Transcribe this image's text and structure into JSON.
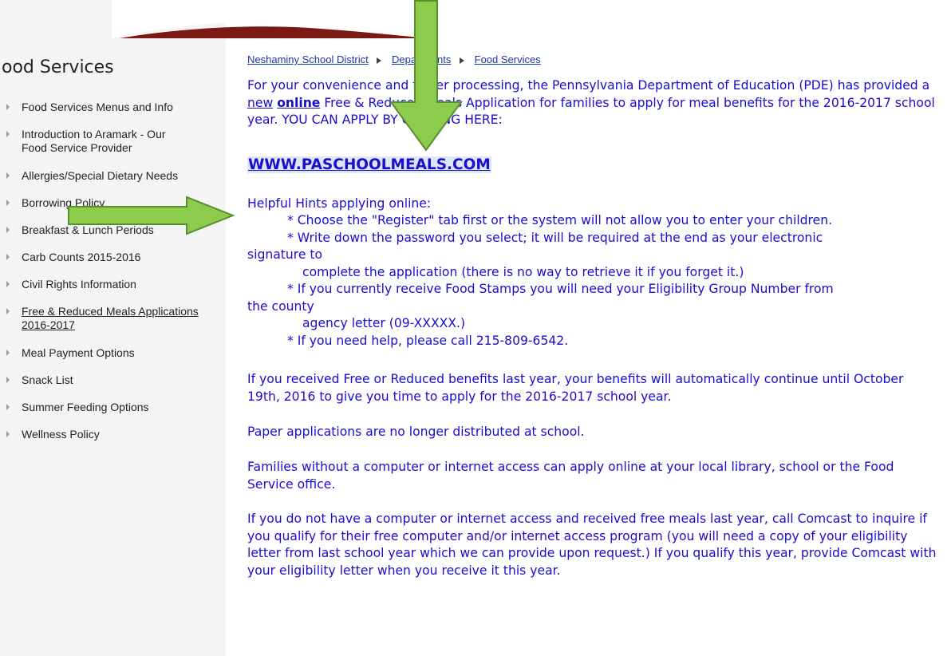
{
  "sidebar": {
    "title": "ood Services",
    "items": [
      {
        "label": "Food Services Menus and Info"
      },
      {
        "label": "Introduction to Aramark - Our Food Service Provider"
      },
      {
        "label": "Allergies/Special Dietary Needs"
      },
      {
        "label": "Borrowing Policy"
      },
      {
        "label": "Breakfast & Lunch Periods"
      },
      {
        "label": "Carb Counts 2015-2016"
      },
      {
        "label": "Civil Rights Information"
      },
      {
        "label": "Free & Reduced Meals Applications 2016-2017"
      },
      {
        "label": "Meal Payment Options"
      },
      {
        "label": "Snack List"
      },
      {
        "label": "Summer Feeding Options"
      },
      {
        "label": "Wellness Policy"
      }
    ]
  },
  "breadcrumb": {
    "district": "Neshaminy School District",
    "departments": "Departments",
    "current": "Food Services"
  },
  "content": {
    "intro_part1": "For your convenience and faster processing, the Pennsylvania Department of Education (PDE) has provided a ",
    "intro_new": "new",
    "intro_online": "online",
    "intro_part2": " Free & Reduced Meals Application for families to apply for meal benefits for the 2016-2017 school year.  YOU CAN APPLY BY CLICKING HERE:",
    "site_link": "WWW.PASCHOOLMEALS.COM",
    "hints_heading": "Helpful Hints applying online:",
    "hint1": "* Choose the \"Register\" tab first or the system will not allow you to enter your children.",
    "hint2a": "* Write down the password you select; it will be required at the end as your electronic",
    "hint2b": "signature to",
    "hint2c": "complete the application (there is no way to retrieve it if you forget it.)",
    "hint3a": "* If you currently receive Food Stamps you will need your Eligibility Group Number from",
    "hint3b": "the county",
    "hint3c": "agency letter (09-XXXXX.)",
    "hint4": "* If you need help, please call 215-809-6542.",
    "para_continue": "If you received Free or Reduced benefits last year, your benefits will automatically continue until October 19th, 2016 to give you time to apply for the 2016-2017 school year.",
    "para_paper": "Paper applications are no longer distributed at school.",
    "para_families": "Families without a computer or internet access can apply online at your local library, school or the Food Service office.",
    "para_comcast": "If you do not have a computer or internet access and received free meals last year, call Comcast to inquire if you qualify for their free computer and/or internet access program (you will need a copy of your eligibility letter from last school year which we can provide upon request.)  If you qualify this year, provide Comcast with your eligibility letter when you receive it this year."
  },
  "colors": {
    "text_blue": "#1a0dd0",
    "arrow_fill": "#8ccb4c",
    "arrow_stroke": "#5a8f2e",
    "swoosh": "#7a1a12"
  }
}
